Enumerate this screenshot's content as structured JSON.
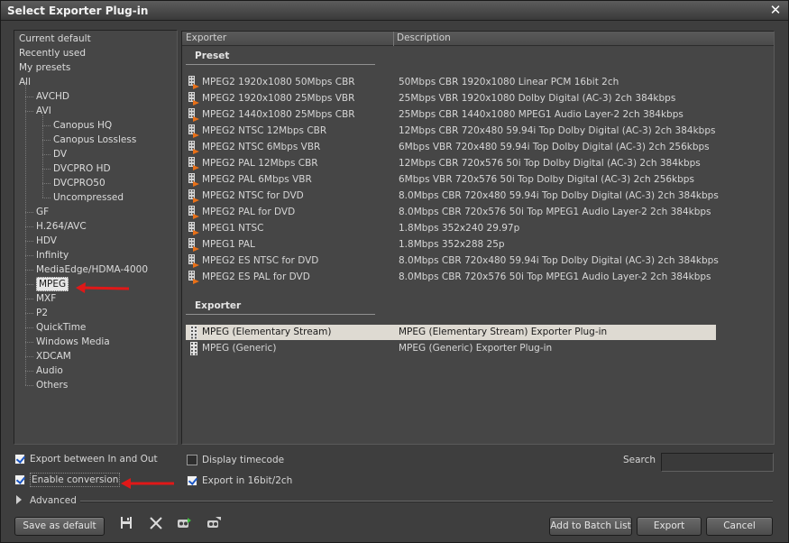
{
  "window": {
    "title": "Select Exporter Plug-in",
    "close_glyph": "✕"
  },
  "tree": {
    "top": [
      {
        "label": "Current default"
      },
      {
        "label": "Recently used"
      },
      {
        "label": "My presets"
      },
      {
        "label": "All"
      }
    ],
    "children": [
      {
        "label": "AVCHD"
      },
      {
        "label": "AVI"
      },
      {
        "label": "Canopus HQ",
        "sub": true
      },
      {
        "label": "Canopus Lossless",
        "sub": true
      },
      {
        "label": "DV",
        "sub": true
      },
      {
        "label": "DVCPRO HD",
        "sub": true
      },
      {
        "label": "DVCPRO50",
        "sub": true
      },
      {
        "label": "Uncompressed",
        "sub": true
      },
      {
        "label": "GF"
      },
      {
        "label": "H.264/AVC"
      },
      {
        "label": "HDV"
      },
      {
        "label": "Infinity"
      },
      {
        "label": "MediaEdge/HDMA-4000"
      },
      {
        "label": "MPEG",
        "selected": true
      },
      {
        "label": "MXF"
      },
      {
        "label": "P2"
      },
      {
        "label": "QuickTime"
      },
      {
        "label": "Windows Media"
      },
      {
        "label": "XDCAM"
      },
      {
        "label": "Audio"
      },
      {
        "label": "Others"
      }
    ]
  },
  "list": {
    "columns": {
      "exporter": "Exporter",
      "description": "Description"
    },
    "preset_group": "Preset",
    "exporter_group": "Exporter",
    "presets": [
      {
        "name": "MPEG2 1920x1080 50Mbps CBR",
        "desc": "50Mbps CBR 1920x1080 Linear PCM 16bit 2ch"
      },
      {
        "name": "MPEG2 1920x1080 25Mbps VBR",
        "desc": "25Mbps VBR 1920x1080 Dolby Digital (AC-3) 2ch 384kbps"
      },
      {
        "name": "MPEG2 1440x1080 25Mbps CBR",
        "desc": "25Mbps CBR 1440x1080 MPEG1 Audio Layer-2 2ch 384kbps"
      },
      {
        "name": "MPEG2 NTSC 12Mbps CBR",
        "desc": "12Mbps CBR 720x480 59.94i Top Dolby Digital (AC-3) 2ch 384kbps"
      },
      {
        "name": "MPEG2 NTSC 6Mbps VBR",
        "desc": "6Mbps VBR 720x480 59.94i Top Dolby Digital (AC-3) 2ch 256kbps"
      },
      {
        "name": "MPEG2 PAL 12Mbps CBR",
        "desc": "12Mbps CBR 720x576 50i Top Dolby Digital (AC-3) 2ch 384kbps"
      },
      {
        "name": "MPEG2 PAL 6Mbps VBR",
        "desc": "6Mbps VBR 720x576 50i Top Dolby Digital (AC-3) 2ch 256kbps"
      },
      {
        "name": "MPEG2 NTSC for DVD",
        "desc": "8.0Mbps CBR 720x480 59.94i Top Dolby Digital (AC-3) 2ch 384kbps"
      },
      {
        "name": "MPEG2 PAL for DVD",
        "desc": "8.0Mbps CBR 720x576 50i Top MPEG1 Audio Layer-2 2ch 384kbps"
      },
      {
        "name": "MPEG1 NTSC",
        "desc": "1.8Mbps 352x240 29.97p"
      },
      {
        "name": "MPEG1 PAL",
        "desc": "1.8Mbps 352x288 25p"
      },
      {
        "name": "MPEG2 ES NTSC for DVD",
        "desc": "8.0Mbps CBR 720x480 59.94i Top Dolby Digital (AC-3) 2ch 384kbps"
      },
      {
        "name": "MPEG2 ES PAL for DVD",
        "desc": "8.0Mbps CBR 720x576 50i Top MPEG1 Audio Layer-2 2ch 384kbps"
      }
    ],
    "exporters": [
      {
        "name": "MPEG (Elementary Stream)",
        "desc": "MPEG (Elementary Stream) Exporter Plug-in",
        "selected": true
      },
      {
        "name": "MPEG (Generic)",
        "desc": "MPEG (Generic) Exporter Plug-in"
      }
    ]
  },
  "options": {
    "export_in_out": {
      "label": "Export between In and Out",
      "checked": true
    },
    "enable_conversion": {
      "label": "Enable conversion",
      "checked": true
    },
    "display_timecode": {
      "label": "Display timecode",
      "checked": false
    },
    "export_16bit": {
      "label": "Export in 16bit/2ch",
      "checked": true
    }
  },
  "search": {
    "label": "Search",
    "value": ""
  },
  "advanced": {
    "label": "Advanced"
  },
  "buttons": {
    "save_default": "Save as default",
    "add_batch": "Add to Batch List",
    "export": "Export",
    "cancel": "Cancel"
  },
  "icons": {
    "save": "save-icon",
    "delete": "delete-icon",
    "import": "import-preset-icon",
    "export": "export-preset-icon",
    "preset": "film-preset-icon",
    "plugin": "film-strip-icon"
  },
  "colors": {
    "annotation_arrow": "#e01818",
    "selection": "#dedad2",
    "check": "#1b56c4"
  }
}
